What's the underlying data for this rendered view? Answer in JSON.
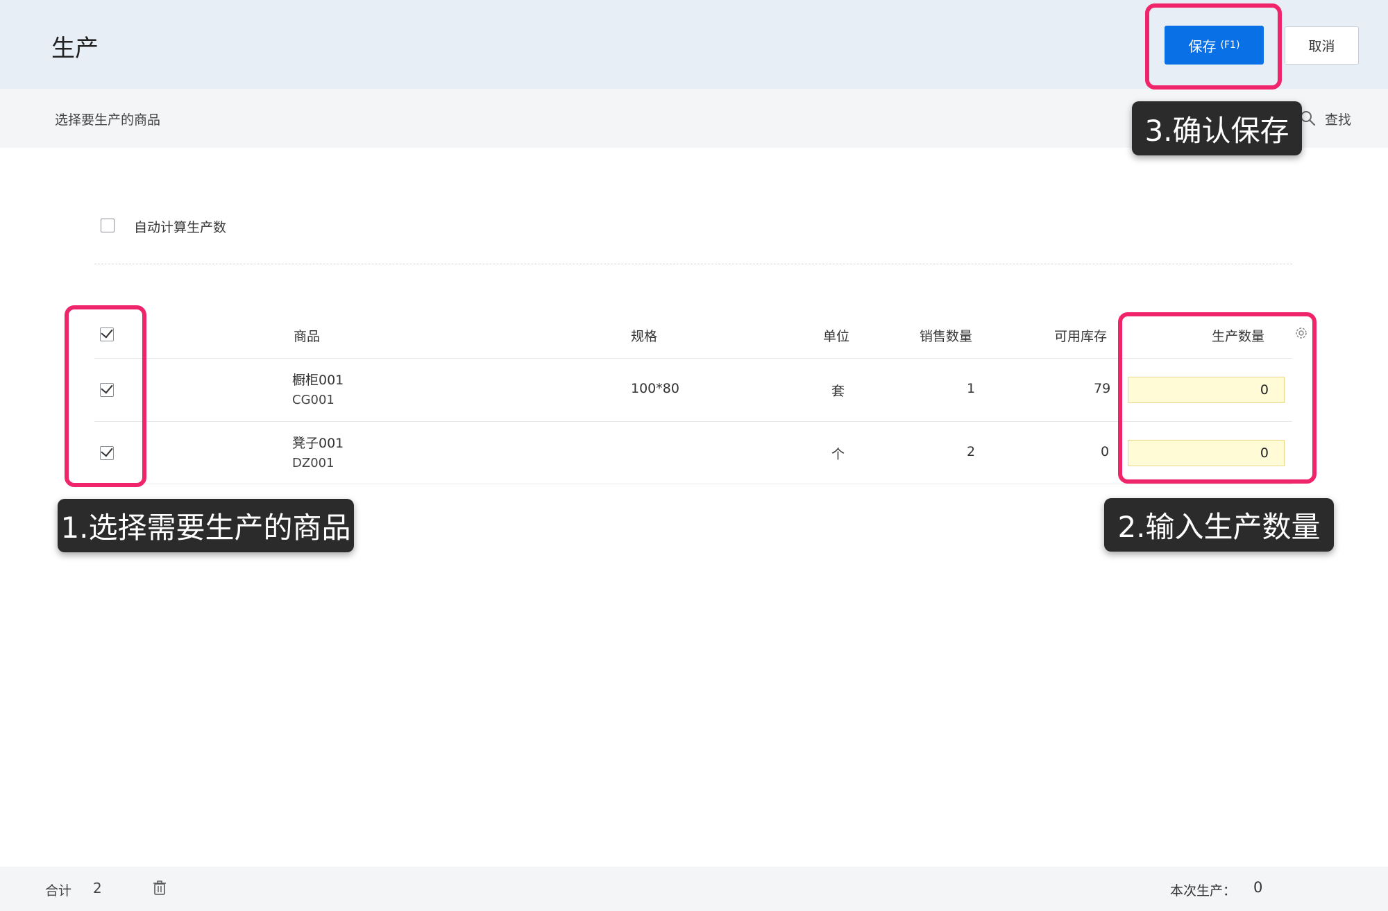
{
  "header": {
    "title": "生产",
    "save_label": "保存",
    "save_shortcut": "(F1)",
    "cancel_label": "取消"
  },
  "toolbar": {
    "label": "选择要生产的商品",
    "search_label": "查找"
  },
  "options": {
    "auto_calc_label": "自动计算生产数",
    "auto_calc_checked": false
  },
  "table": {
    "columns": [
      "商品",
      "规格",
      "单位",
      "销售数量",
      "可用库存",
      "生产数量"
    ],
    "rows": [
      {
        "name": "橱柜001",
        "code": "CG001",
        "spec": "100*80",
        "unit": "套",
        "sales_qty": "1",
        "stock": "79",
        "production_qty": "0",
        "checked": true
      },
      {
        "name": "凳子001",
        "code": "DZ001",
        "spec": "",
        "unit": "个",
        "sales_qty": "2",
        "stock": "0",
        "production_qty": "0",
        "checked": true
      }
    ],
    "select_all_checked": true
  },
  "annotations": {
    "step1": "1.选择需要生产的商品",
    "step2": "2.输入生产数量",
    "step3": "3.确认保存",
    "highlight_color": "#f0246a"
  },
  "footer": {
    "total_label": "合计",
    "total_count": "2",
    "production_label": "本次生产：",
    "production_value": "0"
  },
  "colors": {
    "primary": "#0a70e6",
    "header_bg": "#e8eef5",
    "input_bg": "#fffbd6"
  }
}
